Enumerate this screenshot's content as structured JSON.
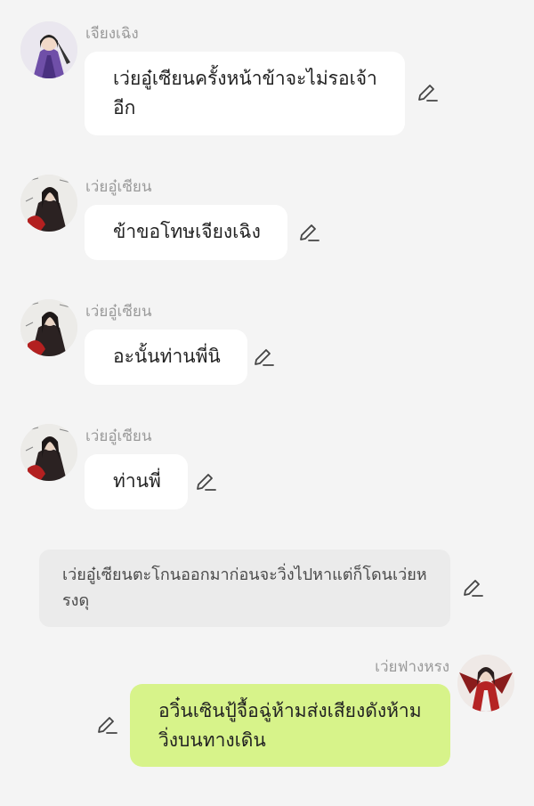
{
  "messages": [
    {
      "sender": "เจียงเฉิง",
      "text": "เว่ยอู๋เซียนครั้งหน้าข้าจะไม่รอเจ้าอีก",
      "avatar_icon": "purple-robed-character-avatar-icon"
    },
    {
      "sender": "เว่ยอู๋เซียน",
      "text": "ข้าขอโทษเจียงเฉิง",
      "avatar_icon": "black-red-robed-character-avatar-icon"
    },
    {
      "sender": "เว่ยอู๋เซียน",
      "text": "อะนั้นท่านพี่นิ",
      "avatar_icon": "black-red-robed-character-avatar-icon"
    },
    {
      "sender": "เว่ยอู๋เซียน",
      "text": "ท่านพี่",
      "avatar_icon": "black-red-robed-character-avatar-icon"
    }
  ],
  "narration": {
    "text": "เว่ยอู๋เซียนตะโกนออกมาก่อนจะวิ่งไปหาแต่ก็โดนเว่ยหรงดุ"
  },
  "my_message": {
    "sender": "เว่ยฟางหรง",
    "text": "อวิ๋นเซินปู้จื้อฉู่ห้ามส่งเสียงดังห้ามวิ่งบนทางเดิน",
    "avatar_icon": "red-winged-character-avatar-icon"
  },
  "colors": {
    "background": "#f4f4f4",
    "bubble": "#ffffff",
    "my_bubble": "#d7f38a",
    "narration_bg": "#ebebeb"
  }
}
